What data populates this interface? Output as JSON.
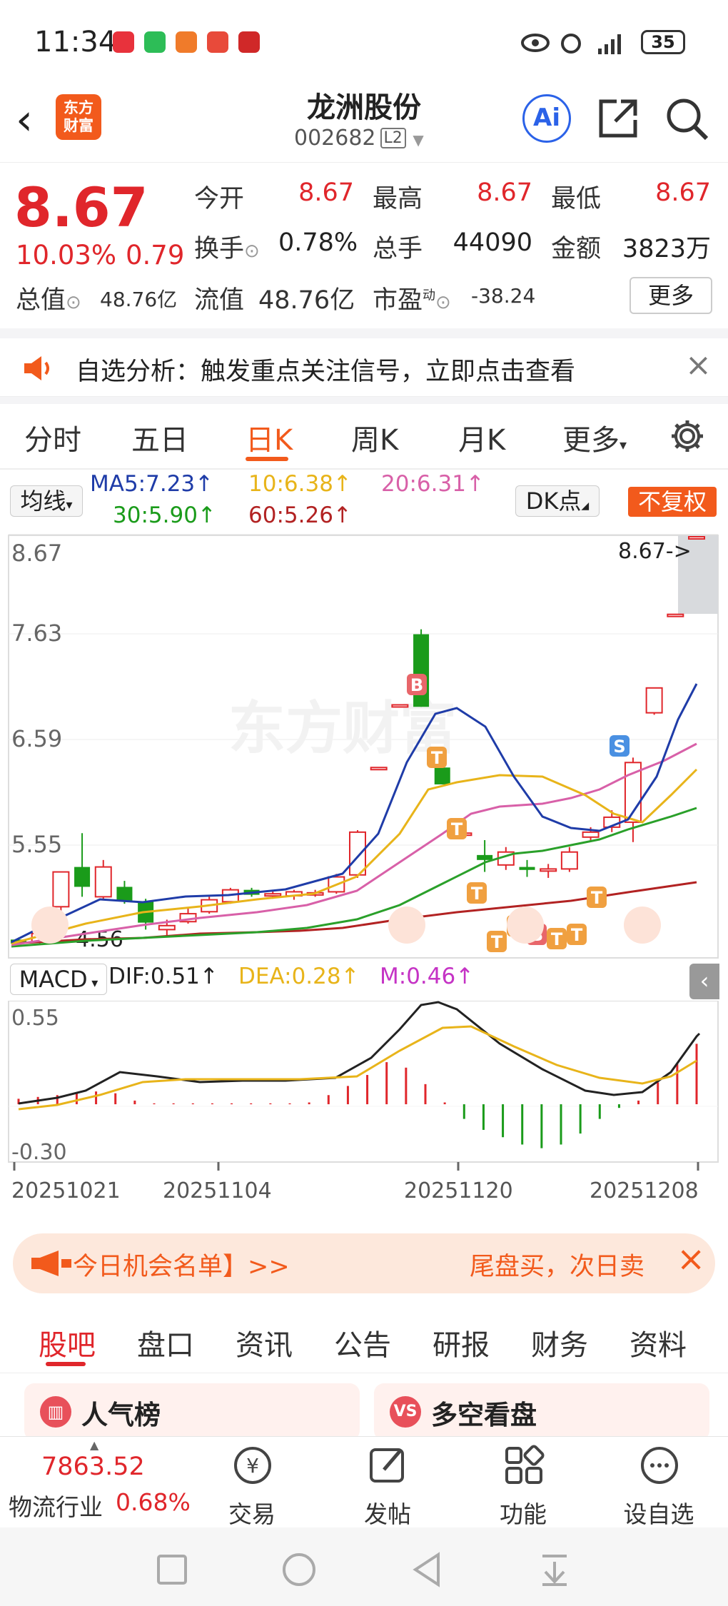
{
  "status_bar": {
    "time": "11:34",
    "battery": "35"
  },
  "header": {
    "logo_text_1": "东方",
    "logo_text_2": "财富",
    "stock_name": "龙洲股份",
    "stock_code": "002682",
    "level_badge": "L2",
    "ai_label": "Ai"
  },
  "quote": {
    "price": "8.67",
    "change_pct": "10.03%",
    "change_amt": "0.79",
    "open_label": "今开",
    "open_value": "8.67",
    "high_label": "最高",
    "high_value": "8.67",
    "low_label": "最低",
    "low_value": "8.67",
    "turnover_label": "换手",
    "turnover_value": "0.78%",
    "volume_label": "总手",
    "volume_value": "44090",
    "amount_label": "金额",
    "amount_value": "3823万",
    "mktcap_label": "总值",
    "mktcap_value": "48.76亿",
    "float_label": "流值",
    "float_value": "48.76亿",
    "pe_label": "市盈",
    "pe_sup": "动",
    "pe_value": "-38.24",
    "more_button": "更多"
  },
  "notice": {
    "text": "自选分析：触发重点关注信号，立即点击查看"
  },
  "chart_tabs": [
    "分时",
    "五日",
    "日K",
    "周K",
    "月K",
    "更多"
  ],
  "active_chart_tab": "日K",
  "ma_legend": {
    "selector": "均线",
    "ma5": "MA5:7.23↑",
    "ma10": "10:6.38↑",
    "ma20": "20:6.31↑",
    "ma30": "30:5.90↑",
    "ma60": "60:5.26↑",
    "dk_button": "DK点",
    "fq_button": "不复权"
  },
  "chart_colors": {
    "up": "#e0262b",
    "down": "#1a9b1a",
    "ma5": "#1f3ca8",
    "ma10": "#e8b41a",
    "ma20": "#d860a8",
    "ma30": "#2aa02a",
    "ma60": "#b22222",
    "dea": "#e8b41a",
    "m": "#c533c5"
  },
  "chart_data": [
    {
      "type": "candlestick",
      "y_ticks": [
        "8.67",
        "7.63",
        "6.59",
        "5.55"
      ],
      "price_marker": "8.67->",
      "low_marker": "4.56",
      "ylim": [
        4.45,
        8.67
      ],
      "candles": [
        {
          "o": 4.62,
          "h": 4.64,
          "l": 4.56,
          "c": 4.58
        },
        {
          "o": 4.6,
          "h": 4.7,
          "l": 4.58,
          "c": 4.68
        },
        {
          "o": 4.95,
          "h": 5.25,
          "l": 4.9,
          "c": 5.3
        },
        {
          "o": 5.35,
          "h": 5.69,
          "l": 5.05,
          "c": 5.15
        },
        {
          "o": 5.05,
          "h": 5.42,
          "l": 5.02,
          "c": 5.35
        },
        {
          "o": 5.15,
          "h": 5.21,
          "l": 4.98,
          "c": 5.01
        },
        {
          "o": 5.0,
          "h": 5.03,
          "l": 4.72,
          "c": 4.79
        },
        {
          "o": 4.72,
          "h": 4.82,
          "l": 4.66,
          "c": 4.76
        },
        {
          "o": 4.8,
          "h": 4.94,
          "l": 4.78,
          "c": 4.88
        },
        {
          "o": 4.9,
          "h": 5.05,
          "l": 4.88,
          "c": 5.02
        },
        {
          "o": 5.0,
          "h": 5.14,
          "l": 4.98,
          "c": 5.12
        },
        {
          "o": 5.12,
          "h": 5.14,
          "l": 5.05,
          "c": 5.07
        },
        {
          "o": 5.06,
          "h": 5.12,
          "l": 5.03,
          "c": 5.08
        },
        {
          "o": 5.06,
          "h": 5.12,
          "l": 5.02,
          "c": 5.1
        },
        {
          "o": 5.08,
          "h": 5.12,
          "l": 5.05,
          "c": 5.09
        },
        {
          "o": 5.1,
          "h": 5.28,
          "l": 5.08,
          "c": 5.25
        },
        {
          "o": 5.27,
          "h": 5.72,
          "l": 5.24,
          "c": 5.7
        },
        {
          "o": 6.35,
          "h": 6.35,
          "l": 6.35,
          "c": 6.35
        },
        {
          "o": 6.98,
          "h": 6.98,
          "l": 6.98,
          "c": 6.98
        },
        {
          "o": 7.69,
          "h": 7.74,
          "l": 6.96,
          "c": 6.96
        },
        {
          "o": 6.35,
          "h": 6.4,
          "l": 6.18,
          "c": 6.18
        },
        {
          "o": 5.68,
          "h": 5.84,
          "l": 5.66,
          "c": 5.69
        },
        {
          "o": 5.47,
          "h": 5.62,
          "l": 5.3,
          "c": 5.42
        },
        {
          "o": 5.37,
          "h": 5.55,
          "l": 5.32,
          "c": 5.5
        },
        {
          "o": 5.35,
          "h": 5.42,
          "l": 5.25,
          "c": 5.32
        },
        {
          "o": 5.32,
          "h": 5.38,
          "l": 5.24,
          "c": 5.33
        },
        {
          "o": 5.33,
          "h": 5.55,
          "l": 5.3,
          "c": 5.5
        },
        {
          "o": 5.65,
          "h": 5.75,
          "l": 5.6,
          "c": 5.7
        },
        {
          "o": 5.75,
          "h": 5.92,
          "l": 5.7,
          "c": 5.85
        },
        {
          "o": 5.8,
          "h": 6.45,
          "l": 5.6,
          "c": 6.4
        },
        {
          "o": 6.9,
          "h": 7.15,
          "l": 6.88,
          "c": 7.15
        },
        {
          "o": 7.89,
          "h": 7.89,
          "l": 7.89,
          "c": 7.89
        },
        {
          "o": 8.67,
          "h": 8.67,
          "l": 8.67,
          "c": 8.67
        }
      ]
    },
    {
      "type": "macd",
      "dif": "DIF:0.51↑",
      "dea": "DEA:0.28↑",
      "m": "M:0.46↑",
      "selector": "MACD",
      "y_ticks": [
        "0.55",
        "-0.30"
      ],
      "ylim": [
        -0.3,
        0.55
      ],
      "x_ticks": [
        "20251021",
        "20251104",
        "20251120",
        "20251208"
      ]
    }
  ],
  "banner": {
    "left": "今日机会名单】>>",
    "right": "尾盘买，次日卖"
  },
  "bottom_tabs": [
    "股吧",
    "盘口",
    "资讯",
    "公告",
    "研报",
    "财务",
    "资料"
  ],
  "cards": {
    "left": "人气榜",
    "right": "多空看盘"
  },
  "bottom_nav": {
    "index_value": "7863.52",
    "industry": "物流行业",
    "industry_pct": "0.68%",
    "trade": "交易",
    "post": "发帖",
    "function": "功能",
    "watch": "设自选"
  }
}
